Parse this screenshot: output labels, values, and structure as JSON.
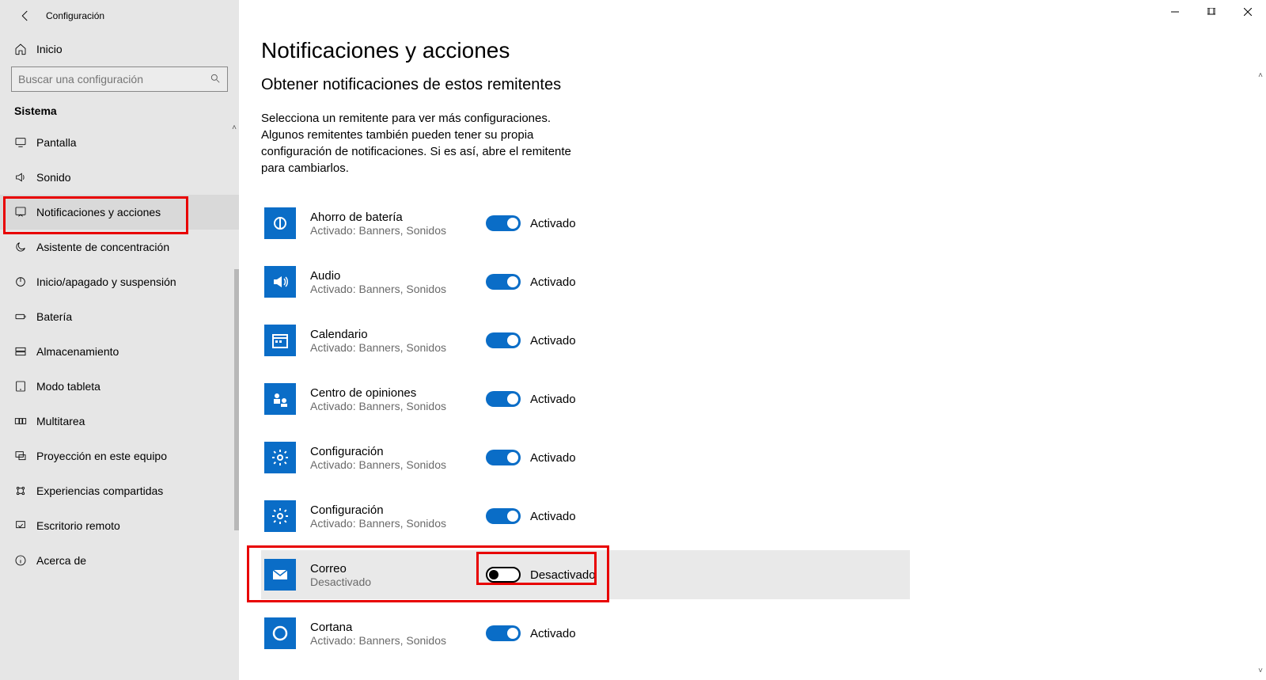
{
  "window": {
    "title": "Configuración"
  },
  "sidebar": {
    "home_label": "Inicio",
    "search_placeholder": "Buscar una configuración",
    "category": "Sistema",
    "items": [
      {
        "label": "Pantalla",
        "icon": "display"
      },
      {
        "label": "Sonido",
        "icon": "sound"
      },
      {
        "label": "Notificaciones y acciones",
        "icon": "notify",
        "selected": true
      },
      {
        "label": "Asistente de concentración",
        "icon": "moon"
      },
      {
        "label": "Inicio/apagado y suspensión",
        "icon": "power"
      },
      {
        "label": "Batería",
        "icon": "battery"
      },
      {
        "label": "Almacenamiento",
        "icon": "storage"
      },
      {
        "label": "Modo tableta",
        "icon": "tablet"
      },
      {
        "label": "Multitarea",
        "icon": "multitask"
      },
      {
        "label": "Proyección en este equipo",
        "icon": "project"
      },
      {
        "label": "Experiencias compartidas",
        "icon": "share"
      },
      {
        "label": "Escritorio remoto",
        "icon": "remote"
      },
      {
        "label": "Acerca de",
        "icon": "about"
      }
    ]
  },
  "main": {
    "title": "Notificaciones y acciones",
    "section": "Obtener notificaciones de estos remitentes",
    "description": "Selecciona un remitente para ver más configuraciones. Algunos remitentes también pueden tener su propia configuración de notificaciones. Si es así, abre el remitente para cambiarlos.",
    "state_on": "Activado",
    "state_off": "Desactivado",
    "sub_on": "Activado: Banners, Sonidos",
    "sub_off": "Desactivado",
    "senders": [
      {
        "name": "Ahorro de batería",
        "on": true,
        "icon": "battery-saver"
      },
      {
        "name": "Audio",
        "on": true,
        "icon": "audio"
      },
      {
        "name": "Calendario",
        "on": true,
        "icon": "calendar"
      },
      {
        "name": "Centro de opiniones",
        "on": true,
        "icon": "feedback"
      },
      {
        "name": "Configuración",
        "on": true,
        "icon": "settings"
      },
      {
        "name": "Configuración",
        "on": true,
        "icon": "settings"
      },
      {
        "name": "Correo",
        "on": false,
        "icon": "mail",
        "highlighted": true
      },
      {
        "name": "Cortana",
        "on": true,
        "icon": "cortana"
      }
    ]
  }
}
